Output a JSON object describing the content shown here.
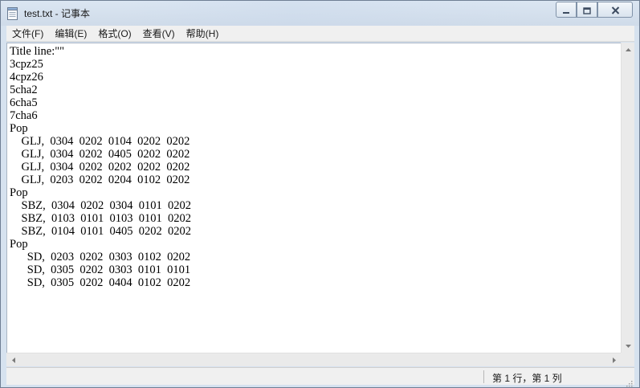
{
  "window": {
    "title": "test.txt - 记事本"
  },
  "menu": {
    "items": [
      "文件(F)",
      "编辑(E)",
      "格式(O)",
      "查看(V)",
      "帮助(H)"
    ]
  },
  "editor": {
    "content": "Title line:\"\"\n3cpz25\n4cpz26\n5cha2\n6cha5\n7cha6\nPop\n    GLJ,  0304  0202  0104  0202  0202\n    GLJ,  0304  0202  0405  0202  0202\n    GLJ,  0304  0202  0202  0202  0202\n    GLJ,  0203  0202  0204  0102  0202\nPop\n    SBZ,  0304  0202  0304  0101  0202\n    SBZ,  0103  0101  0103  0101  0202\n    SBZ,  0104  0101  0405  0202  0202\nPop\n      SD,  0203  0202  0303  0102  0202\n      SD,  0305  0202  0303  0101  0101\n      SD,  0305  0202  0404  0102  0202"
  },
  "statusbar": {
    "position": "第 1 行，第 1 列"
  },
  "icons": {
    "app": "notepad-icon",
    "minimize": "minimize-icon",
    "maximize": "maximize-icon",
    "close": "close-icon"
  },
  "colors": {
    "chrome": "#d6e2ef",
    "menu_bg": "#f0f0f0",
    "editor_bg": "#ffffff",
    "close_x": "#3c4b60"
  }
}
